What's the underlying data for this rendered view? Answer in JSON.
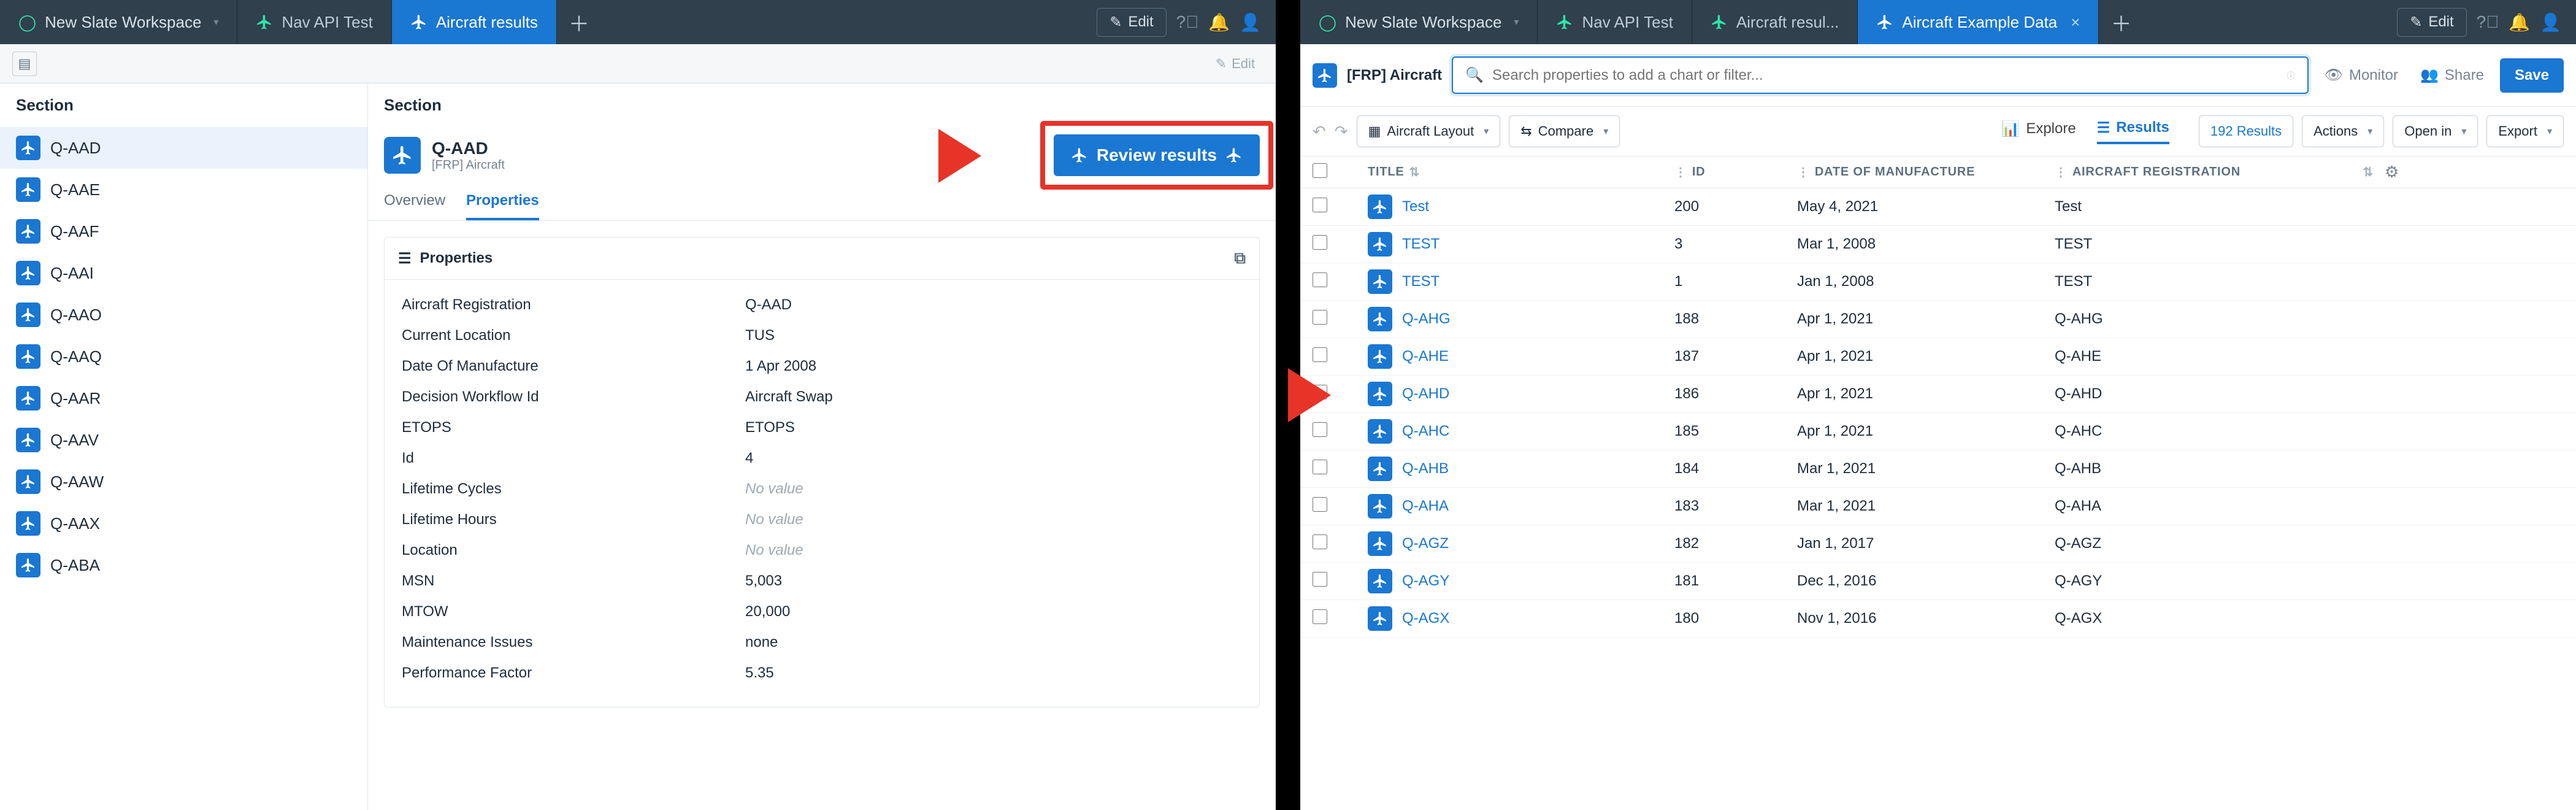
{
  "left": {
    "tabs": {
      "workspace": "New Slate Workspace",
      "nav": "Nav API Test",
      "results": "Aircraft results",
      "edit": "Edit"
    },
    "subbar_edit": "Edit",
    "section_left_header": "Section",
    "section_right_header": "Section",
    "list": [
      "Q-AAD",
      "Q-AAE",
      "Q-AAF",
      "Q-AAI",
      "Q-AAO",
      "Q-AAQ",
      "Q-AAR",
      "Q-AAV",
      "Q-AAW",
      "Q-AAX",
      "Q-ABA"
    ],
    "detail": {
      "title": "Q-AAD",
      "subtitle": "[FRP] Aircraft",
      "review_btn": "Review results"
    },
    "dtabs": {
      "overview": "Overview",
      "properties": "Properties"
    },
    "props_title": "Properties",
    "props": [
      {
        "k": "Aircraft Registration",
        "v": "Q-AAD"
      },
      {
        "k": "Current Location",
        "v": "TUS"
      },
      {
        "k": "Date Of Manufacture",
        "v": "1 Apr 2008"
      },
      {
        "k": "Decision Workflow Id",
        "v": "Aircraft Swap"
      },
      {
        "k": "ETOPS",
        "v": "ETOPS"
      },
      {
        "k": "Id",
        "v": "4"
      },
      {
        "k": "Lifetime Cycles",
        "v": "No value",
        "nv": true
      },
      {
        "k": "Lifetime Hours",
        "v": "No value",
        "nv": true
      },
      {
        "k": "Location",
        "v": "No value",
        "nv": true
      },
      {
        "k": "MSN",
        "v": "5,003"
      },
      {
        "k": "MTOW",
        "v": "20,000"
      },
      {
        "k": "Maintenance Issues",
        "v": "none"
      },
      {
        "k": "Performance Factor",
        "v": "5.35"
      }
    ]
  },
  "right": {
    "tabs": {
      "workspace": "New Slate Workspace",
      "nav": "Nav API Test",
      "results": "Aircraft resul...",
      "example": "Aircraft Example Data",
      "edit": "Edit"
    },
    "context_label": "[FRP] Aircraft",
    "search_placeholder": "Search properties to add a chart or filter...",
    "monitor": "Monitor",
    "share": "Share",
    "save": "Save",
    "toolbar": {
      "layout": "Aircraft Layout",
      "compare": "Compare",
      "explore": "Explore",
      "results": "Results",
      "count": "192 Results",
      "actions": "Actions",
      "openin": "Open in",
      "export": "Export"
    },
    "columns": {
      "title": "TITLE",
      "id": "ID",
      "dom": "DATE OF MANUFACTURE",
      "reg": "AIRCRAFT REGISTRATION"
    },
    "rows": [
      {
        "title": "Test",
        "id": "200",
        "dom": "May 4, 2021",
        "reg": "Test"
      },
      {
        "title": "TEST",
        "id": "3",
        "dom": "Mar 1, 2008",
        "reg": "TEST"
      },
      {
        "title": "TEST",
        "id": "1",
        "dom": "Jan 1, 2008",
        "reg": "TEST"
      },
      {
        "title": "Q-AHG",
        "id": "188",
        "dom": "Apr 1, 2021",
        "reg": "Q-AHG"
      },
      {
        "title": "Q-AHE",
        "id": "187",
        "dom": "Apr 1, 2021",
        "reg": "Q-AHE"
      },
      {
        "title": "Q-AHD",
        "id": "186",
        "dom": "Apr 1, 2021",
        "reg": "Q-AHD"
      },
      {
        "title": "Q-AHC",
        "id": "185",
        "dom": "Apr 1, 2021",
        "reg": "Q-AHC"
      },
      {
        "title": "Q-AHB",
        "id": "184",
        "dom": "Mar 1, 2021",
        "reg": "Q-AHB"
      },
      {
        "title": "Q-AHA",
        "id": "183",
        "dom": "Mar 1, 2021",
        "reg": "Q-AHA"
      },
      {
        "title": "Q-AGZ",
        "id": "182",
        "dom": "Jan 1, 2017",
        "reg": "Q-AGZ"
      },
      {
        "title": "Q-AGY",
        "id": "181",
        "dom": "Dec 1, 2016",
        "reg": "Q-AGY"
      },
      {
        "title": "Q-AGX",
        "id": "180",
        "dom": "Nov 1, 2016",
        "reg": "Q-AGX"
      }
    ]
  }
}
